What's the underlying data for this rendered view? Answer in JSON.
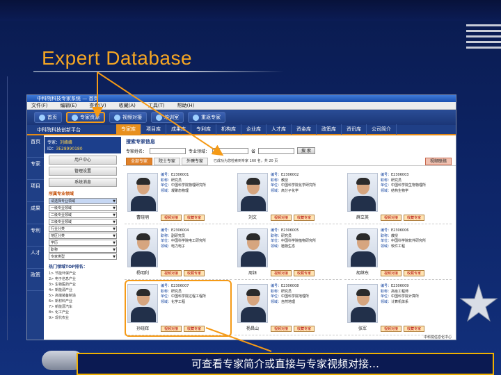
{
  "slide": {
    "title": "Expert Database",
    "caption": "可查看专家简介或直接与专家视频对接…"
  },
  "app": {
    "window_title": "中科院科技专家系统 — 首页",
    "menu": [
      "文件(F)",
      "编辑(E)",
      "查看(V)",
      "收藏(A)",
      "工具(T)",
      "帮助(H)"
    ],
    "toolbar": [
      {
        "label": "首页",
        "active": false
      },
      {
        "label": "专家资源",
        "active": true
      },
      {
        "label": "视频对接",
        "active": false
      },
      {
        "label": "培训室",
        "active": false
      },
      {
        "label": "重返专家",
        "active": false
      }
    ],
    "brand": "中科院科技创新平台",
    "nav_tabs": [
      {
        "label": "专家库",
        "active": true
      },
      {
        "label": "项目库",
        "active": false
      },
      {
        "label": "成果库",
        "active": false
      },
      {
        "label": "专利库",
        "active": false
      },
      {
        "label": "机构库",
        "active": false
      },
      {
        "label": "企业库",
        "active": false
      },
      {
        "label": "人才库",
        "active": false
      },
      {
        "label": "资金库",
        "active": false
      },
      {
        "label": "政策库",
        "active": false
      },
      {
        "label": "资讯库",
        "active": false
      },
      {
        "label": "公司简介",
        "active": false
      }
    ],
    "left_bar": [
      "首页",
      "专家",
      "项目",
      "成果",
      "专利",
      "人才",
      "政策"
    ],
    "user": {
      "line1": "专家：",
      "name": "刘峰峰",
      "line2": "ID：",
      "id": "3E28990180"
    },
    "side_buttons": [
      "用户中心",
      "管理设置",
      "系统消息"
    ],
    "category_title": "所属专业领域",
    "category_selects": [
      "请选择专业领域",
      "一级专业领域",
      "二级专业领域",
      "三级专业领域",
      "行业分类",
      "地区分类",
      "学历",
      "职称",
      "专家类型"
    ],
    "list_title": "热门领域TOP排名：",
    "list_items": [
      "1> 节能环保产业",
      "2> 电子信息产业",
      "3> 生物医药产业",
      "4> 新能源产业",
      "5> 高端装备制造",
      "6> 新材料产业",
      "7> 新能源汽车",
      "8> 化工产业",
      "9> 现代农业"
    ],
    "main_title": "搜索专家信息",
    "search_labels": [
      "专家姓名：",
      "专业领域：",
      "省"
    ],
    "search_button": "搜 索",
    "tabs": [
      {
        "label": "全部专家",
        "active": true
      },
      {
        "label": "院士专家",
        "active": false
      },
      {
        "label": "外聘专家",
        "active": false
      }
    ],
    "tab_note": "已成功为您检索到专家 160 名，共 20 页",
    "video_button": "视频联络",
    "experts": [
      {
        "name": "曹晓明",
        "no": "E2306001",
        "job": "研究员",
        "org": "中国科学院物理研究所",
        "field": "凝聚态物理"
      },
      {
        "name": "刘文",
        "no": "E2306002",
        "job": "教授",
        "org": "中国科学院化学研究所",
        "field": "高分子化学"
      },
      {
        "name": "薛立英",
        "no": "E2306003",
        "job": "研究员",
        "org": "中国科学院生物物理所",
        "field": "结构生物学"
      },
      {
        "name": "杨明利",
        "no": "E2306004",
        "job": "副研究员",
        "org": "中国科学院电工研究所",
        "field": "电力电子"
      },
      {
        "name": "周钰",
        "no": "E2306005",
        "job": "研究员",
        "org": "中国科学院植物研究所",
        "field": "植物生态"
      },
      {
        "name": "胡继东",
        "no": "E2306006",
        "job": "教授",
        "org": "中国科学院软件研究所",
        "field": "软件工程"
      },
      {
        "name": "孙晓辉",
        "no": "E2306007",
        "job": "研究员",
        "org": "中国科学院过程工程所",
        "field": "化学工程"
      },
      {
        "name": "杨昌山",
        "no": "E2306008",
        "job": "研究员",
        "org": "中国科学院地理所",
        "field": "自然地理"
      },
      {
        "name": "张军",
        "no": "E2306009",
        "job": "高级工程师",
        "org": "中国科学院计算所",
        "field": "计算机体系"
      }
    ],
    "card_keys": {
      "no": "编号：",
      "job": "职称：",
      "org": "单位：",
      "field": "领域："
    },
    "card_buttons": [
      "视频对接",
      "收藏专家"
    ],
    "footer": "中科院信息化中心"
  }
}
